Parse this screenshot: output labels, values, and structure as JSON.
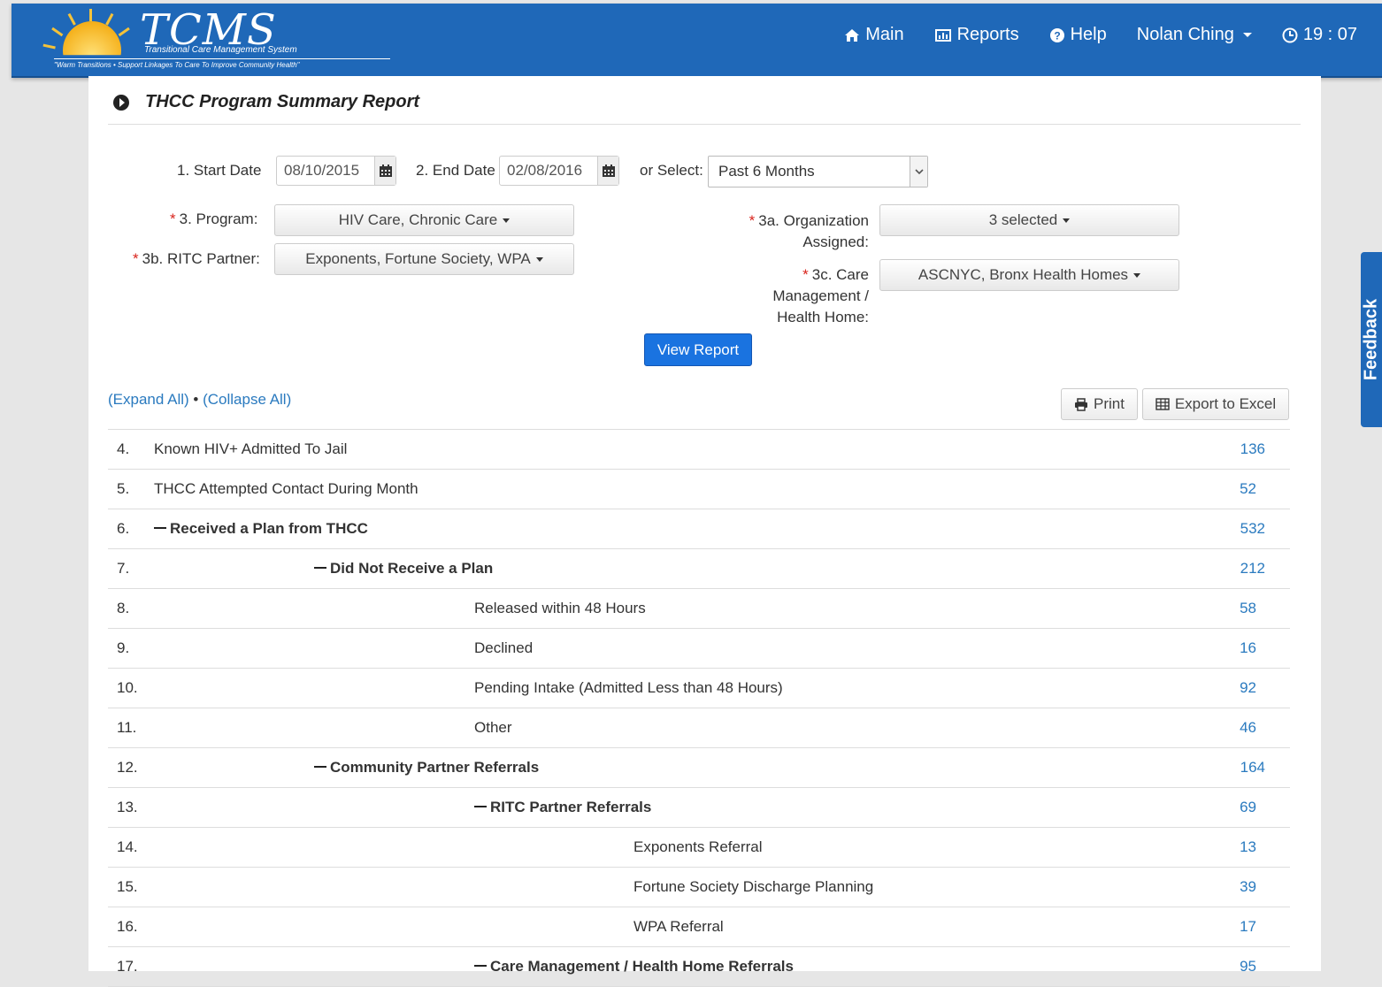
{
  "header": {
    "logo_title": "TCMS",
    "logo_subtitle": "Transitional Care Management System",
    "logo_tagline": "\"Warm Transitions • Support Linkages To Care To Improve Community Health\"",
    "nav": {
      "main": "Main",
      "reports": "Reports",
      "help": "Help",
      "user": "Nolan Ching",
      "clock": "19 : 07"
    },
    "brand_color": "#1f68b8"
  },
  "page": {
    "title": "THCC Program Summary Report"
  },
  "form": {
    "start_date_label": "1. Start Date",
    "start_date_value": "08/10/2015",
    "end_date_label": "2. End Date",
    "end_date_value": "02/08/2016",
    "or_select_label": "or Select:",
    "or_select_value": "Past 6 Months",
    "program_label": "3. Program:",
    "program_value": "HIV Care, Chronic Care",
    "org_label_line1": "3a. Organization",
    "org_label_line2": "Assigned:",
    "org_value": "3 selected",
    "ritc_label": "3b. RITC Partner:",
    "ritc_value": "Exponents, Fortune Society, WPA",
    "care_label_line1": "3c. Care",
    "care_label_line2": "Management /",
    "care_label_line3": "Health Home:",
    "care_value": "ASCNYC, Bronx Health Homes",
    "view_report": "View Report"
  },
  "toolbar": {
    "expand_all": "(Expand All)",
    "separator": "•",
    "collapse_all": "(Collapse All)",
    "print": "Print",
    "export": "Export to Excel"
  },
  "rows": [
    {
      "num": "4.",
      "label": "Known HIV+ Admitted To Jail",
      "value": "136",
      "level": 0,
      "bold": false,
      "collapsible": false
    },
    {
      "num": "5.",
      "label": "THCC Attempted Contact During Month",
      "value": "52",
      "level": 0,
      "bold": false,
      "collapsible": false
    },
    {
      "num": "6.",
      "label": "Received a Plan from THCC",
      "value": "532",
      "level": 0,
      "bold": true,
      "collapsible": true
    },
    {
      "num": "7.",
      "label": "Did Not Receive a Plan",
      "value": "212",
      "level": 1,
      "bold": true,
      "collapsible": true
    },
    {
      "num": "8.",
      "label": "Released within 48 Hours",
      "value": "58",
      "level": 2,
      "bold": false,
      "collapsible": false
    },
    {
      "num": "9.",
      "label": "Declined",
      "value": "16",
      "level": 2,
      "bold": false,
      "collapsible": false
    },
    {
      "num": "10.",
      "label": "Pending Intake (Admitted Less than 48 Hours)",
      "value": "92",
      "level": 2,
      "bold": false,
      "collapsible": false
    },
    {
      "num": "11.",
      "label": "Other",
      "value": "46",
      "level": 2,
      "bold": false,
      "collapsible": false
    },
    {
      "num": "12.",
      "label": "Community Partner Referrals",
      "value": "164",
      "level": 1,
      "bold": true,
      "collapsible": true
    },
    {
      "num": "13.",
      "label": "RITC Partner Referrals",
      "value": "69",
      "level": 2,
      "bold": true,
      "collapsible": true
    },
    {
      "num": "14.",
      "label": "Exponents Referral",
      "value": "13",
      "level": 3,
      "bold": false,
      "collapsible": false
    },
    {
      "num": "15.",
      "label": "Fortune Society Discharge Planning",
      "value": "39",
      "level": 3,
      "bold": false,
      "collapsible": false
    },
    {
      "num": "16.",
      "label": "WPA Referral",
      "value": "17",
      "level": 3,
      "bold": false,
      "collapsible": false
    },
    {
      "num": "17.",
      "label": "Care Management / Health Home Referrals",
      "value": "95",
      "level": 2,
      "bold": true,
      "collapsible": true
    }
  ],
  "feedback": "Feedback"
}
